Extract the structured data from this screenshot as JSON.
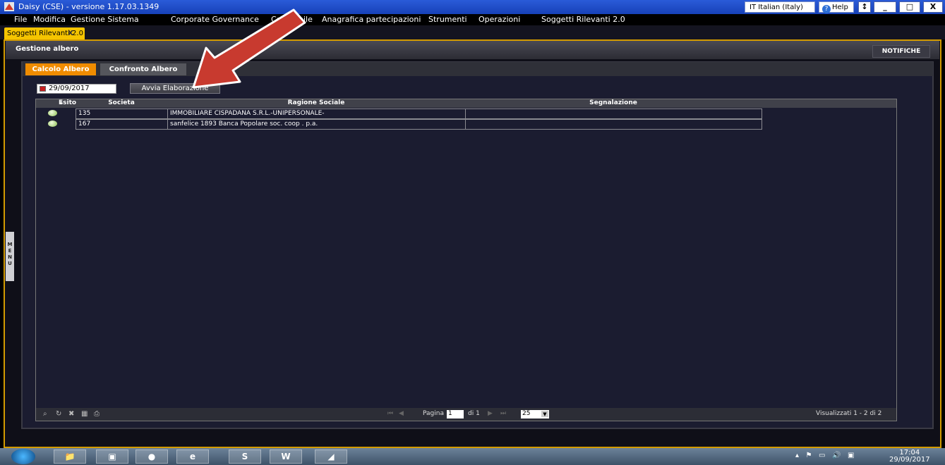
{
  "window": {
    "title": "Daisy (CSE) - versione 1.17.03.1349",
    "language": "IT  Italian (Italy)",
    "help": "Help",
    "controls": [
      "_",
      "□",
      "X"
    ]
  },
  "menubar": [
    "File",
    "Modifica",
    "Gestione Sistema",
    "Corporate Governance",
    "Co",
    "bile",
    "Anagrafica partecipazioni",
    "Strumenti",
    "Operazioni",
    "Soggetti Rilevanti 2.0"
  ],
  "doc_tab": {
    "label": "Soggetti Rilevanti 2.0",
    "close": "X"
  },
  "header": {
    "title": "Gestione albero",
    "notifications_button": "NOTIFICHE"
  },
  "side_menu": {
    "label": "MENU"
  },
  "tabs": [
    {
      "label": "Calcolo Albero",
      "active": true
    },
    {
      "label": "Confronto Albero",
      "active": false
    }
  ],
  "toolbar": {
    "date_value": "29/09/2017",
    "run_button": "Avvia Elaborazione"
  },
  "grid": {
    "columns": [
      "Esito",
      "Societa",
      "Ragione Sociale",
      "Segnalazione"
    ],
    "rows": [
      {
        "esito": "ok",
        "societa": "135",
        "ragione_sociale": "IMMOBILIARE CISPADANA S.R.L.-UNIPERSONALE-",
        "segnalazione": ""
      },
      {
        "esito": "ok",
        "societa": "167",
        "ragione_sociale": "sanfelice 1893 Banca Popolare  soc. coop . p.a.",
        "segnalazione": ""
      }
    ]
  },
  "pagination": {
    "page_label": "Pagina",
    "page_value": "1",
    "of_label": "di 1",
    "page_size": "25",
    "status": "Visualizzati 1 - 2 di 2"
  },
  "taskbar": {
    "time": "17:04",
    "date": "29/09/2017"
  },
  "colors": {
    "accent_orange": "#f08c00",
    "tab_yellow": "#f5c400",
    "annotation_arrow": "#c83a2f"
  }
}
